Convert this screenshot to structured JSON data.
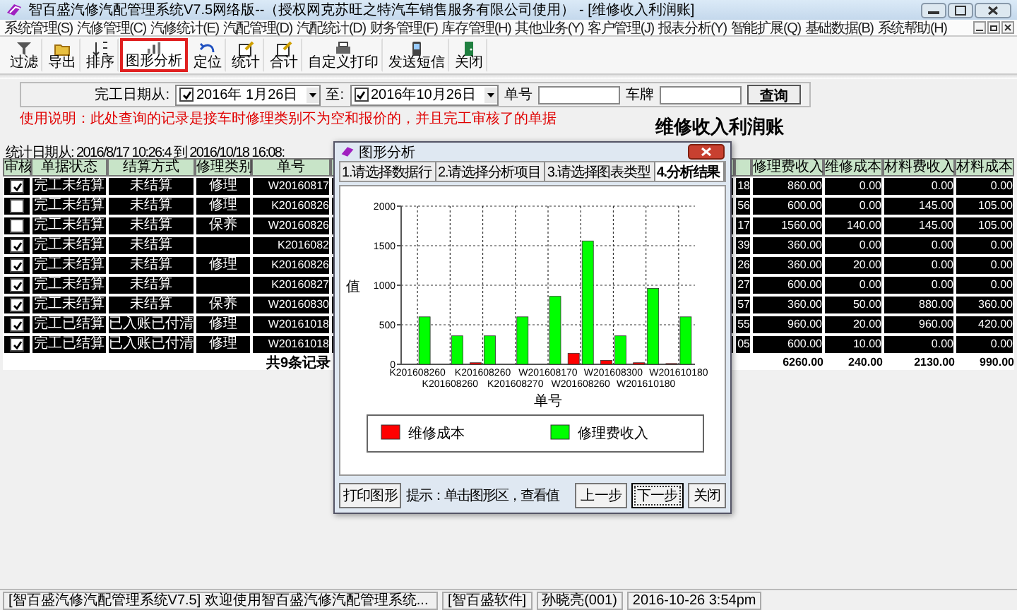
{
  "window": {
    "title": "智百盛汽修汽配管理系统V7.5网络版--（授权网克苏旺之特汽车销售服务有限公司使用） - [维修收入利润账]"
  },
  "menu": [
    "系统管理(S)",
    "汽修管理(C)",
    "汽修统计(E)",
    "汽配管理(D)",
    "汽配统计(D)",
    "财务管理(F)",
    "库存管理(H)",
    "其他业务(Y)",
    "客户管理(J)",
    "报表分析(Y)",
    "智能扩展(Q)",
    "基础数据(B)",
    "系统帮助(H)"
  ],
  "toolbar": [
    {
      "label": "过滤",
      "selected": false
    },
    {
      "label": "导出",
      "selected": false
    },
    {
      "label": "排序",
      "selected": false
    },
    {
      "label": "图形分析",
      "selected": true
    },
    {
      "label": "定位",
      "selected": false
    },
    {
      "label": "统计",
      "selected": false
    },
    {
      "label": "合计",
      "selected": false
    },
    {
      "label": "自定义打印",
      "selected": false
    },
    {
      "label": "发送短信",
      "selected": false
    },
    {
      "label": "关闭",
      "selected": false
    }
  ],
  "filter": {
    "from_label": "完工日期从:",
    "from_checked": true,
    "from_value": "2016年 1月26日",
    "to_label": "至:",
    "to_checked": true,
    "to_value": "2016年10月26日",
    "number_label": "单号",
    "plate_label": "车牌",
    "query_button": "查询"
  },
  "notice": "使用说明：此处查询的记录是接车时修理类别不为空和报价的，并且完工审核了的单据",
  "report": {
    "title": "维修收入利润账",
    "stats": "统计日期从:   2016/8/17 10:26:4 到 2016/10/18 16:08:"
  },
  "table": {
    "columns": [
      "审核",
      "单据状态",
      "结算方式",
      "修理类别",
      "单号",
      "修理费收入",
      "维修成本",
      "材料费收入",
      "材料成本"
    ],
    "rows": [
      {
        "checked": true,
        "status": "完工未结算",
        "settlement": "未结算",
        "category": "修理",
        "number": "W20160817",
        "column_6": "18",
        "repair_income": "860.00",
        "repair_cost": "0.00",
        "material_income": "0.00",
        "material_cost": "0.00"
      },
      {
        "checked": false,
        "status": "完工未结算",
        "settlement": "未结算",
        "category": "修理",
        "number": "K20160826",
        "column_6": "56",
        "repair_income": "600.00",
        "repair_cost": "0.00",
        "material_income": "145.00",
        "material_cost": "105.00"
      },
      {
        "checked": false,
        "status": "完工未结算",
        "settlement": "未结算",
        "category": "保养",
        "number": "W20160826",
        "column_6": "17",
        "repair_income": "1560.00",
        "repair_cost": "140.00",
        "material_income": "145.00",
        "material_cost": "105.00"
      },
      {
        "checked": true,
        "status": "完工未结算",
        "settlement": "未结算",
        "number": "K2016082",
        "column_6": "39",
        "repair_income": "360.00",
        "repair_cost": "0.00",
        "material_income": "0.00",
        "material_cost": "0.00"
      },
      {
        "checked": true,
        "status": "完工未结算",
        "settlement": "未结算",
        "category": "修理",
        "number": "K20160826",
        "column_6": "26",
        "repair_income": "360.00",
        "repair_cost": "20.00",
        "material_income": "0.00",
        "material_cost": "0.00"
      },
      {
        "checked": true,
        "status": "完工未结算",
        "settlement": "未结算",
        "number": "K20160827",
        "column_6": "27",
        "repair_income": "600.00",
        "repair_cost": "0.00",
        "material_income": "0.00",
        "material_cost": "0.00"
      },
      {
        "checked": true,
        "status": "完工未结算",
        "settlement": "未结算",
        "category": "保养",
        "number": "W20160830",
        "column_6": "57",
        "repair_income": "360.00",
        "repair_cost": "50.00",
        "material_income": "880.00",
        "material_cost": "360.00"
      },
      {
        "checked": true,
        "status": "完工已结算",
        "settlement": "已入账已付清",
        "category": "修理",
        "number": "W20161018",
        "column_6": "55",
        "repair_income": "960.00",
        "repair_cost": "20.00",
        "material_income": "960.00",
        "material_cost": "420.00"
      },
      {
        "checked": true,
        "status": "完工已结算",
        "settlement": "已入账已付清",
        "category": "修理",
        "number": "W20161018",
        "column_6": "05",
        "repair_income": "600.00",
        "repair_cost": "10.00",
        "material_income": "0.00",
        "material_cost": "0.00"
      }
    ],
    "total": {
      "count": "共9条记录",
      "repair_income": "6260.00",
      "repair_cost": "240.00",
      "material_income": "2130.00",
      "material_cost": "990.00"
    }
  },
  "dialog": {
    "title": "图形分析",
    "tabs": [
      {
        "label": "1.请选择数据行",
        "selected": false
      },
      {
        "label": "2.请选择分析项目",
        "selected": false
      },
      {
        "label": "3.请选择图表类型",
        "selected": false
      },
      {
        "label": "4.分析结果",
        "selected": true
      }
    ],
    "chart_data": {
      "type": "bar",
      "xlabel": "单号",
      "ylabel": "值",
      "categories": [
        "K201608260",
        "K201608260",
        "K201608260",
        "K201608270",
        "W201608170",
        "W201608260",
        "W201608300",
        "W201610180",
        "W201610180"
      ],
      "series": [
        {
          "name": "维修成本",
          "color": "#ff0000",
          "values": [
            0,
            0,
            20,
            0,
            0,
            140,
            50,
            20,
            10
          ]
        },
        {
          "name": "修理费收入",
          "color": "#00ff00",
          "values": [
            600,
            360,
            360,
            600,
            860,
            1560,
            360,
            960,
            600
          ]
        }
      ],
      "ylim": [
        0,
        2000
      ],
      "yticks": [
        0,
        500,
        1000,
        1500,
        2000
      ],
      "grid": true,
      "legend": "bottom"
    },
    "print_button": "打印图形",
    "hint": "提示：单击图形区，查看值",
    "buttons": [
      {
        "label": "上一步",
        "selected": false
      },
      {
        "label": "下一步",
        "selected": true
      },
      {
        "label": "关闭",
        "selected": false
      }
    ]
  },
  "status_bar": [
    "[智百盛汽修汽配管理系统V7.5] 欢迎使用智百盛汽修汽配管理系统...",
    "[智百盛软件]",
    "孙晓亮(001)",
    "2016-10-26 3:54pm"
  ]
}
